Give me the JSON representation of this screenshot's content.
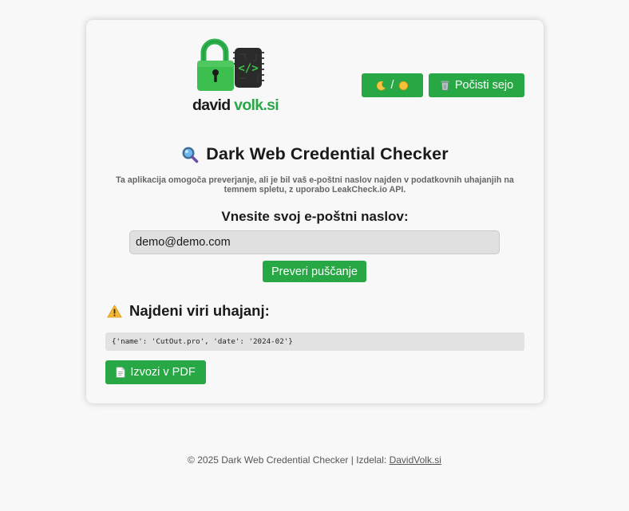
{
  "logo": {
    "text_part1": "david",
    "text_part2": "volk.si"
  },
  "toolbar": {
    "theme_separator": "/",
    "clear_label": "Počisti sejo"
  },
  "main": {
    "title": "Dark Web Credential Checker",
    "description": "Ta aplikacija omogoča preverjanje, ali je bil vaš e-poštni naslov najden v podatkovnih uhajanjih na temnem spletu, z uporabo LeakCheck.io API.",
    "email_label": "Vnesite svoj e-poštni naslov:",
    "email_value": "demo@demo.com",
    "check_button": "Preveri puščanje"
  },
  "results": {
    "title": "Najdeni viri uhajanj:",
    "entries": [
      "{'name': 'CutOut.pro', 'date': '2024-02'}"
    ],
    "export_button": "Izvozi v PDF"
  },
  "footer": {
    "text": "© 2025 Dark Web Credential Checker | Izdelal: ",
    "link_text": "DavidVolk.si"
  },
  "colors": {
    "accent": "#28a745",
    "page_background": "#f8f8f8",
    "input_background": "#e0e0e0",
    "result_background": "#e2e2e2"
  },
  "icons": {
    "title": "magnifier-icon",
    "results": "warning-icon",
    "theme": [
      "moon-icon",
      "sun-icon"
    ],
    "clear": "wastebasket-icon",
    "export": "document-icon"
  }
}
